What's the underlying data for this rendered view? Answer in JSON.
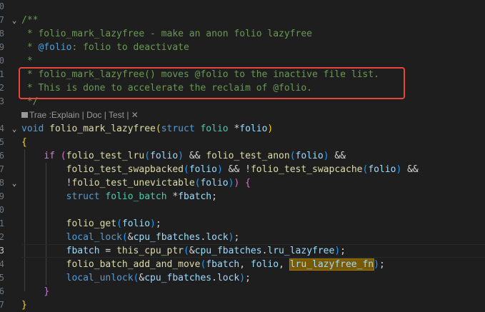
{
  "editor": {
    "line_numbers": [
      "0",
      "7",
      "8",
      "9",
      "0",
      "1",
      "2",
      "3",
      "",
      "4",
      "5",
      "6",
      "7",
      "8",
      "9",
      "0",
      "1",
      "2",
      "3",
      "4",
      "5",
      "6",
      "7"
    ],
    "current_line_number": "3",
    "codelens": {
      "trae": "Trae :Explain",
      "sep1": " | ",
      "doc": "Doc",
      "sep2": " | ",
      "test": "Test",
      "sep3": " | ",
      "close": "✕"
    },
    "colors": {
      "annotation_box": "#e8453c",
      "highlight_bg": "#7a5a00"
    },
    "code": {
      "l1_open": "/**",
      "l2": " * folio_mark_lazyfree - make an anon folio lazyfree",
      "l3_star": " * ",
      "l3_tag": "@folio",
      "l3_rest": ": folio to deactivate",
      "l4": " *",
      "l5": " * folio_mark_lazyfree() moves @folio to the inactive file list.",
      "l6": " * This is done to accelerate the reclaim of @folio.",
      "l7": " */",
      "l8_kw": "void",
      "l8_fn": "folio_mark_lazyfree",
      "l8_p1": "(",
      "l8_struct": "struct",
      "l8_type": "folio",
      "l8_star": " *",
      "l8_param": "folio",
      "l8_p2": ")",
      "l9": "{",
      "l10_if": "if",
      "l10_fn1": "folio_test_lru",
      "l10_arg1": "folio",
      "l10_and": " && ",
      "l10_fn2": "folio_test_anon",
      "l10_arg2": "folio",
      "l10_end": " &&",
      "l11_fn1": "folio_test_swapbacked",
      "l11_arg1": "folio",
      "l11_and": " && !",
      "l11_fn2": "folio_test_swapcache",
      "l11_arg2": "folio",
      "l11_end": " &&",
      "l12_not": "!",
      "l12_fn": "folio_test_unevictable",
      "l12_arg": "folio",
      "l12_brace": "{",
      "l13_struct": "struct",
      "l13_type": "folio_batch",
      "l13_star": " *",
      "l13_var": "fbatch",
      "l13_semi": ";",
      "l15_fn": "folio_get",
      "l15_arg": "folio",
      "l16_fn": "local_lock",
      "l16_amp": "&",
      "l16_var": "cpu_fbatches",
      "l16_mem": "lock",
      "l17_var": "fbatch",
      "l17_eq": " = ",
      "l17_fn": "this_cpu_ptr",
      "l17_amp": "&",
      "l17_var2": "cpu_fbatches",
      "l17_mem": "lru_lazyfree",
      "l18_fn": "folio_batch_add_and_move",
      "l18_a1": "fbatch",
      "l18_a2": "folio",
      "l18_a3": "lru_lazyfree_fn",
      "l19_fn": "local_unlock",
      "l19_amp": "&",
      "l19_var": "cpu_fbatches",
      "l19_mem": "lock",
      "l20": "}",
      "l21": "}"
    }
  }
}
